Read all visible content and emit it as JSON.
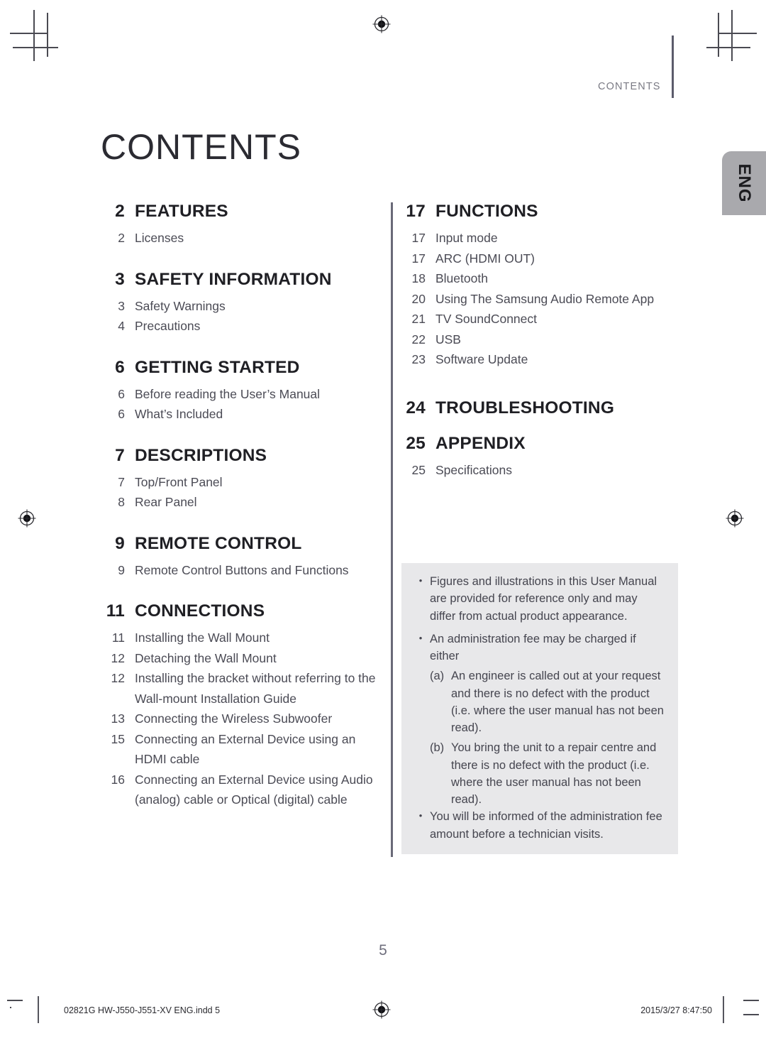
{
  "running_head": "CONTENTS",
  "page_title": "CONTENTS",
  "language_tab": {
    "label": "ENG"
  },
  "colors": {
    "tab_gray": "#a9a9ad",
    "notes_gray": "#e8e8ea",
    "rule_gray": "#6a6a78",
    "text_dark": "#1f1f24",
    "text_body": "#4b4b55"
  },
  "toc": {
    "left_column": [
      {
        "page": "2",
        "title": "FEATURES",
        "items": [
          {
            "page": "2",
            "label": "Licenses"
          }
        ]
      },
      {
        "page": "3",
        "title": "SAFETY INFORMATION",
        "items": [
          {
            "page": "3",
            "label": "Safety Warnings"
          },
          {
            "page": "4",
            "label": "Precautions"
          }
        ]
      },
      {
        "page": "6",
        "title": "GETTING STARTED",
        "items": [
          {
            "page": "6",
            "label": "Before reading the User’s Manual"
          },
          {
            "page": "6",
            "label": "What’s Included"
          }
        ]
      },
      {
        "page": "7",
        "title": "DESCRIPTIONS",
        "items": [
          {
            "page": "7",
            "label": "Top/Front Panel"
          },
          {
            "page": "8",
            "label": "Rear Panel"
          }
        ]
      },
      {
        "page": "9",
        "title": "REMOTE CONTROL",
        "items": [
          {
            "page": "9",
            "label": "Remote Control Buttons and Functions"
          }
        ]
      },
      {
        "page": "11",
        "title": "CONNECTIONS",
        "items": [
          {
            "page": "11",
            "label": "Installing the Wall Mount"
          },
          {
            "page": "12",
            "label": "Detaching the Wall Mount"
          },
          {
            "page": "12",
            "label": "Installing the bracket without referring to the Wall-mount Installation Guide"
          },
          {
            "page": "13",
            "label": "Connecting the Wireless Subwoofer"
          },
          {
            "page": "15",
            "label": "Connecting an External Device using an HDMI cable"
          },
          {
            "page": "16",
            "label": "Connecting an External Device using Audio (analog) cable or Optical (digital) cable"
          }
        ]
      }
    ],
    "right_column": [
      {
        "page": "17",
        "title": "FUNCTIONS",
        "items": [
          {
            "page": "17",
            "label": "Input mode"
          },
          {
            "page": "17",
            "label": "ARC (HDMI OUT)"
          },
          {
            "page": "18",
            "label": "Bluetooth"
          },
          {
            "page": "20",
            "label": "Using The Samsung Audio Remote App"
          },
          {
            "page": "21",
            "label": "TV SoundConnect"
          },
          {
            "page": "22",
            "label": "USB"
          },
          {
            "page": "23",
            "label": "Software Update"
          }
        ]
      },
      {
        "page": "24",
        "title": "TROUBLESHOOTING",
        "items": []
      },
      {
        "page": "25",
        "title": "APPENDIX",
        "items": [
          {
            "page": "25",
            "label": "Specifications"
          }
        ]
      }
    ]
  },
  "notes": {
    "bullet_glyph": "•",
    "entries": [
      {
        "text": "Figures and illustrations in this User Manual are provided for reference only and may differ from actual product appearance."
      },
      {
        "text": "An administration fee may be charged if either",
        "subs": [
          {
            "marker": "(a)",
            "text": "An engineer is called out at your request and there is no defect with the product (i.e. where the user manual has not been read)."
          },
          {
            "marker": "(b)",
            "text": "You bring the unit to a repair centre and there is no defect with the product (i.e. where the user manual has not been read)."
          }
        ]
      },
      {
        "text": "You will be informed of the administration fee amount before a technician visits."
      }
    ]
  },
  "folio": "5",
  "print_footer": {
    "file": "02821G HW-J550-J551-XV ENG.indd   5",
    "timestamp": "2015/3/27   8:47:50"
  }
}
